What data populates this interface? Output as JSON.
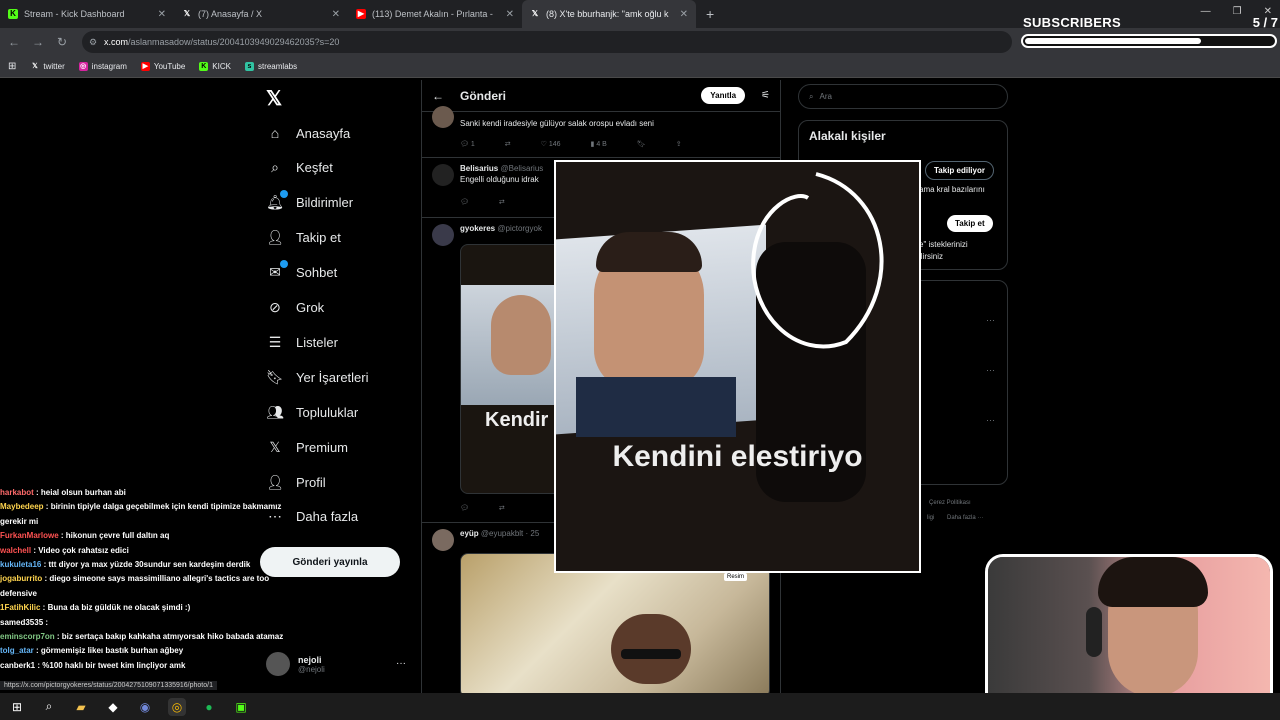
{
  "browser": {
    "tabs": [
      {
        "title": "Stream - Kick Dashboard",
        "icon": "kick-icon"
      },
      {
        "title": "(7) Anasayfa / X",
        "icon": "x-icon"
      },
      {
        "title": "(113) Demet Akalın - Pırlanta -",
        "icon": "youtube-icon"
      },
      {
        "title": "(8) X'te bburhanjk: \"amk oğlu k",
        "icon": "x-icon"
      }
    ],
    "url_host": "x.com",
    "url_path": "/aslanmasadow/status/2004103949029462035?s=20",
    "bookmarks": [
      "twitter",
      "instagram",
      "YouTube",
      "KICK",
      "streamlabs"
    ],
    "status_url": "https://x.com/pictorgyokeres/status/2004275109071335916/photo/1"
  },
  "subscribers": {
    "label": "SUBSCRIBERS",
    "count": "5 / 7",
    "progress": 0.71
  },
  "sidebar": {
    "items": [
      {
        "label": "Anasayfa",
        "icon": "home-icon"
      },
      {
        "label": "Keşfet",
        "icon": "search-icon"
      },
      {
        "label": "Bildirimler",
        "icon": "bell-icon"
      },
      {
        "label": "Takip et",
        "icon": "follow-icon"
      },
      {
        "label": "Sohbet",
        "icon": "chat-icon"
      },
      {
        "label": "Grok",
        "icon": "grok-icon"
      },
      {
        "label": "Listeler",
        "icon": "list-icon"
      },
      {
        "label": "Yer İşaretleri",
        "icon": "bookmark-icon"
      },
      {
        "label": "Topluluklar",
        "icon": "communities-icon"
      },
      {
        "label": "Premium",
        "icon": "x-icon"
      },
      {
        "label": "Profil",
        "icon": "profile-icon"
      },
      {
        "label": "Daha fazla",
        "icon": "more-icon"
      }
    ],
    "post_label": "Gönderi yayınla",
    "profile_name": "nejoli",
    "profile_handle": "@nejoli"
  },
  "main": {
    "title": "Gönderi",
    "reply_label": "Yanıtla",
    "tweets": [
      {
        "name": "",
        "handle": "",
        "text": "Sanki kendi iradesiyle gülüyor salak orospu evladı seni",
        "replies": "1",
        "likes": "146",
        "views": "4 B"
      },
      {
        "name": "Belisarius",
        "handle": "@Belisarius",
        "text": "Engelli olduğunu idrak"
      },
      {
        "name": "gyokeres",
        "handle": "@pictorgyok",
        "media_caption": "Kendir"
      },
      {
        "name": "eyüp",
        "handle": "@eyupakblt · 25"
      }
    ]
  },
  "right": {
    "search_placeholder": "Ara",
    "related_title": "Alakalı kişiler",
    "following_label": "Takip ediliyor",
    "follow_label": "Takip et",
    "bio_fragment": "ama kral bazılarını",
    "note_line1": "e\" isteklerinizi",
    "note_line2": "ilirsiniz",
    "footer": "Çerez Politikası",
    "footer2": "ligi",
    "footer3": "Daha fazla ···"
  },
  "overlay": {
    "caption": "Kendini elestiriyo",
    "tag": "Resim"
  },
  "chat": [
    {
      "user": "harkabot",
      "msg": "heial olsun burhan abi",
      "color": "#ff6b6b"
    },
    {
      "user": "Maybedeep",
      "msg": "birinin tipiyle dalga geçebilmek için kendi tipimize bakmamız gerekir mi",
      "color": "#ffd54f"
    },
    {
      "user": "FurkanMarlowe",
      "msg": "hikonun çevre full daltın aq",
      "color": "#ff5252"
    },
    {
      "user": "walchell",
      "msg": "Video çok rahatsız edici",
      "color": "#ff5252"
    },
    {
      "user": "kukuleta16",
      "msg": "ttt diyor ya max yüzde 30sundur sen kardeşim derdik",
      "color": "#64b5f6"
    },
    {
      "user": "jogaburrito",
      "msg": "diego simeone says massimilliano allegri's tactics are too defensive",
      "color": "#ffd54f"
    },
    {
      "user": "1FatihKilic",
      "msg": "Buna da biz güldük ne olacak şimdi :)",
      "color": "#ffd54f"
    },
    {
      "user": "samed3535",
      "msg": "",
      "color": "#ffffff"
    },
    {
      "user": "eminscorp7on",
      "msg": "biz sertaça bakıp kahkaha atmıyorsak hiko babada atamaz",
      "color": "#81c784"
    },
    {
      "user": "tolg_atar",
      "msg": "görmemişiz likeı bastık burhan ağbey",
      "color": "#64b5f6"
    },
    {
      "user": "canberk1",
      "msg": "%100 haklı bir tweet kim linçliyor amk",
      "color": "#ffffff"
    }
  ]
}
